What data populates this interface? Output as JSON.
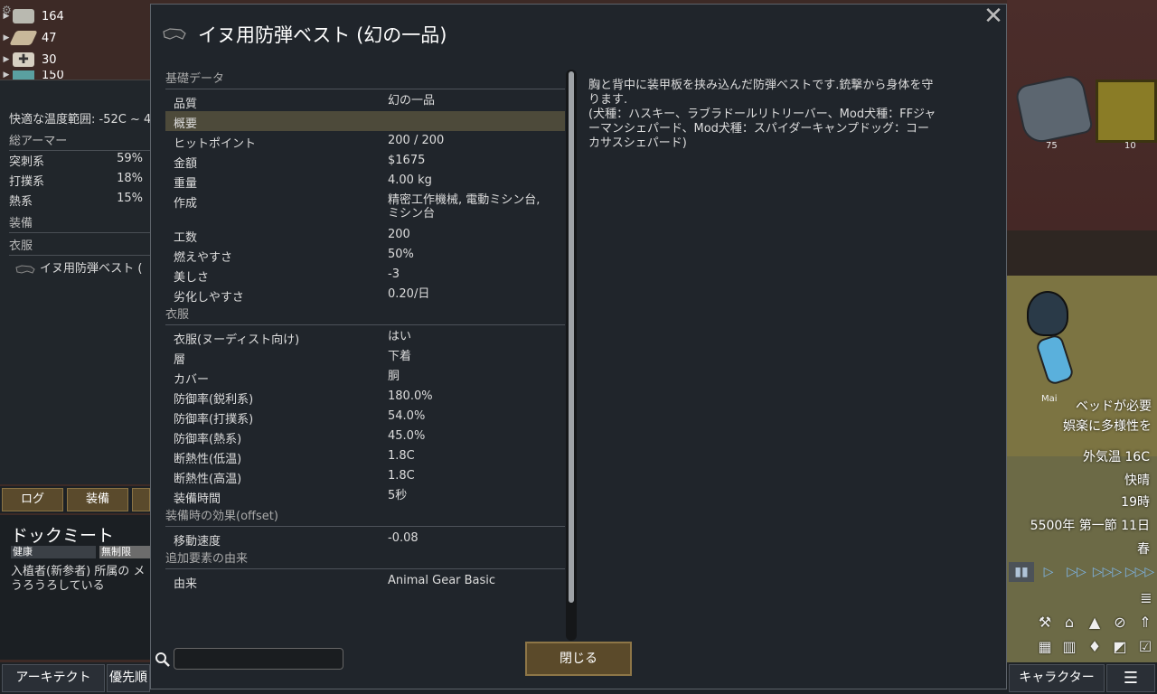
{
  "resources": [
    {
      "icon": "silver-icon",
      "count": "164"
    },
    {
      "icon": "wood-icon",
      "count": "47"
    },
    {
      "icon": "medicine-icon",
      "count": "30"
    },
    {
      "icon": "food-icon",
      "count": "150"
    }
  ],
  "gear_panel": {
    "comfort_temp": "快適な温度範囲: -52C ~ 4",
    "armor_header": "総アーマー",
    "armor": [
      {
        "label": "突刺系",
        "value": "59%"
      },
      {
        "label": "打撲系",
        "value": "18%"
      },
      {
        "label": "熱系",
        "value": "15%"
      }
    ],
    "equipment_header": "装備",
    "apparel_header": "衣服",
    "apparel_item": "イヌ用防弾ベスト ("
  },
  "tabs": {
    "log": "ログ",
    "gear": "装備"
  },
  "pawn": {
    "name": "ドックミート",
    "health": "健康",
    "restriction": "無制限",
    "description": "入植者(新参者) 所属の メ\nうろうろしている"
  },
  "bottom_bar": {
    "architect": "アーキテクト",
    "priority": "優先順",
    "characters": "キャラクター",
    "menu_icon": "list-icon"
  },
  "world": {
    "rock_count": "75",
    "crate_count": "10",
    "pawn_label": "Mai",
    "alerts": [
      "ベッドが必要",
      "娯楽に多様性を"
    ]
  },
  "hud": {
    "outdoor_temp": "外気温 16C",
    "weather": "快晴",
    "hour": "19時",
    "date": "5500年 第一節 11日",
    "season": "春"
  },
  "dialog": {
    "title": "イヌ用防弾ベスト (幻の一品)",
    "close_label": "閉じる",
    "search_placeholder": "",
    "description": "胸と背中に装甲板を挟み込んだ防弾ベストです.銃撃から身体を守\nります.\n(犬種：ハスキー、ラブラドールリトリーバー、Mod犬種：FFジャ\nーマンシェパード、Mod犬種：スパイダーキャンプドッグ：コー\nカサスシェパード)",
    "sections": [
      {
        "header": "基礎データ",
        "rows": [
          {
            "k": "品質",
            "v": "幻の一品"
          },
          {
            "k": "概要",
            "v": ""
          },
          {
            "k": "ヒットポイント",
            "v": "200 / 200"
          },
          {
            "k": "金額",
            "v": "$1675"
          },
          {
            "k": "重量",
            "v": "4.00 kg"
          },
          {
            "k": "作成",
            "v": "精密工作機械, 電動ミシン台,\nミシン台"
          },
          {
            "k": "工数",
            "v": "200"
          },
          {
            "k": "燃えやすさ",
            "v": "50%"
          },
          {
            "k": "美しさ",
            "v": "-3"
          },
          {
            "k": "劣化しやすさ",
            "v": "0.20/日"
          }
        ]
      },
      {
        "header": "衣服",
        "rows": [
          {
            "k": "衣服(ヌーディスト向け)",
            "v": "はい"
          },
          {
            "k": "層",
            "v": "下着"
          },
          {
            "k": "カバー",
            "v": "胴"
          },
          {
            "k": "防御率(鋭利系)",
            "v": "180.0%"
          },
          {
            "k": "防御率(打撲系)",
            "v": "54.0%"
          },
          {
            "k": "防御率(熱系)",
            "v": "45.0%"
          },
          {
            "k": "断熱性(低温)",
            "v": "1.8C"
          },
          {
            "k": "断熱性(高温)",
            "v": "1.8C"
          },
          {
            "k": "装備時間",
            "v": "5秒"
          }
        ]
      },
      {
        "header": "装備時の効果(offset)",
        "rows": [
          {
            "k": "移動速度",
            "v": "-0.08"
          }
        ]
      },
      {
        "header": "追加要素の由来",
        "rows": [
          {
            "k": "由来",
            "v": "Animal Gear Basic"
          }
        ]
      }
    ]
  }
}
